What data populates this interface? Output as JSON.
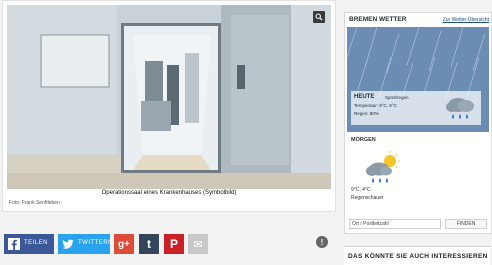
{
  "photo": {
    "caption": "Operationssaal eines Krankenhauses (Symbolbild)",
    "credit": "Foto: Frank Senftleben"
  },
  "share": {
    "facebook_label": "TEILEN",
    "twitter_label": "TWITTERN",
    "gplus_label": "g+",
    "tumblr_label": "t",
    "pinterest_label": "P",
    "mail_label": "✉",
    "info_label": "!"
  },
  "weather": {
    "title": "BREMEN WETTER",
    "link": "Zur Wetter-Übersicht",
    "today": {
      "label": "HEUTE",
      "condition": "Sprühregen",
      "temperature": "Temperatur: 9°C, 8°C",
      "rain": "Regen: 80%"
    },
    "tomorrow": {
      "label": "MORGEN",
      "temperature": "9°C, 4°C",
      "condition": "Regenschauer"
    },
    "search_placeholder": "Ort / Postleitzahl",
    "search_button": "FINDEN"
  },
  "also": {
    "title": "DAS KÖNNTE SIE AUCH INTERESSIEREN"
  },
  "colors": {
    "facebook": "#3b5998",
    "twitter": "#2aa3ef",
    "gplus": "#dd4b39",
    "tumblr": "#35465c",
    "pinterest": "#cb2027"
  }
}
